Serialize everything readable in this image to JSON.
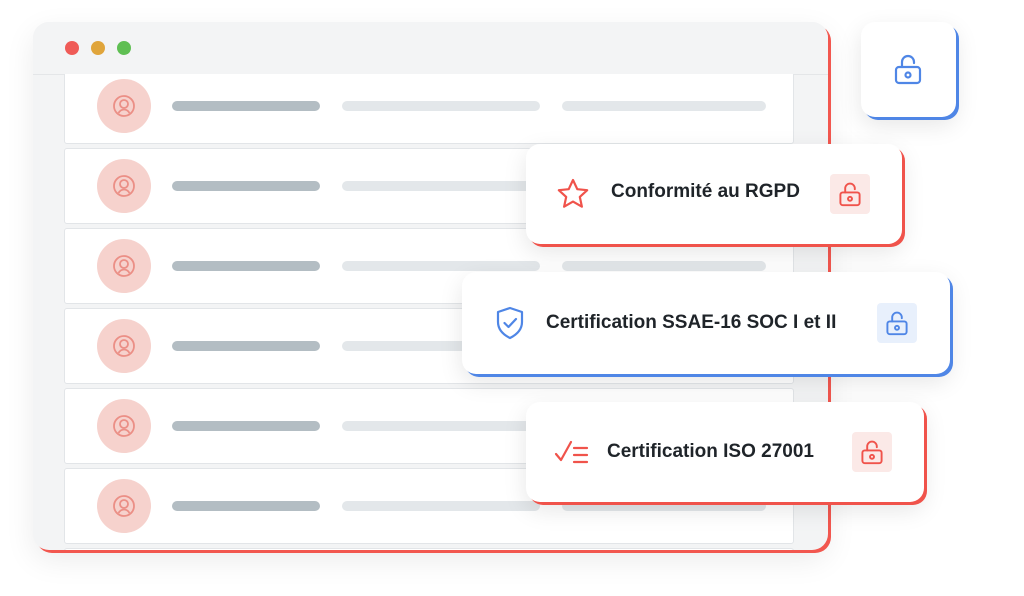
{
  "colors": {
    "accent_red": "#f0534b",
    "accent_blue": "#4f86e6",
    "avatar_bg": "#f6d2cd"
  },
  "window": {
    "traffic_lights": [
      "close",
      "minimize",
      "maximize"
    ],
    "rows": [
      {
        "avatar_icon": "user-icon"
      },
      {
        "avatar_icon": "user-icon"
      },
      {
        "avatar_icon": "user-icon"
      },
      {
        "avatar_icon": "user-icon"
      },
      {
        "avatar_icon": "user-icon"
      },
      {
        "avatar_icon": "user-icon"
      },
      {
        "avatar_icon": "user-icon"
      }
    ]
  },
  "lock_tile": {
    "icon": "unlock-icon",
    "color": "#4f86e6"
  },
  "cards": [
    {
      "label": "Conformité au RGPD",
      "icon": "star-icon",
      "lock_icon": "unlock-icon",
      "accent": "#f0534b"
    },
    {
      "label": "Certification SSAE-16 SOC I et II",
      "icon": "shield-check-icon",
      "lock_icon": "unlock-icon",
      "accent": "#4f86e6"
    },
    {
      "label": "Certification ISO 27001",
      "icon": "checklist-icon",
      "lock_icon": "unlock-icon",
      "accent": "#f0534b"
    }
  ]
}
